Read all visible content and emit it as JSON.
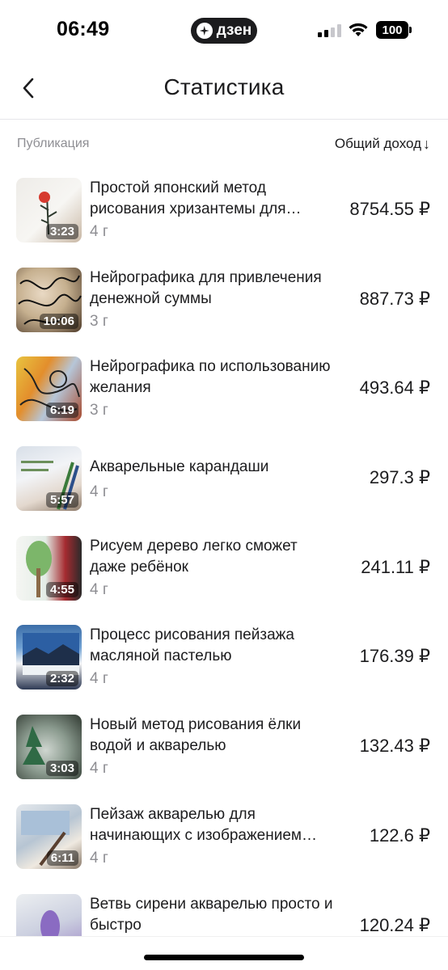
{
  "status_bar": {
    "time": "06:49",
    "app_badge": "дзен",
    "battery": "100"
  },
  "nav": {
    "title": "Статистика"
  },
  "list_header": {
    "publication_label": "Публикация",
    "income_label": "Общий доход",
    "sort_icon": "↓"
  },
  "currency": "₽",
  "items": [
    {
      "title": "Простой японский метод рисования хризантемы для начинающих",
      "age": "4 г",
      "income": "8754.55 ₽",
      "duration": "3:23"
    },
    {
      "title": "Нейрографика для привлечения денежной суммы",
      "age": "3 г",
      "income": "887.73 ₽",
      "duration": "10:06"
    },
    {
      "title": "Нейрографика по использованию желания",
      "age": "3 г",
      "income": "493.64 ₽",
      "duration": "6:19"
    },
    {
      "title": "Акварельные карандаши",
      "age": "4 г",
      "income": "297.3 ₽",
      "duration": "5:57"
    },
    {
      "title": "Рисуем дерево легко сможет даже ребёнок",
      "age": "4 г",
      "income": "241.11 ₽",
      "duration": "4:55"
    },
    {
      "title": "Процесс рисования пейзажа масляной пастелью",
      "age": "4 г",
      "income": "176.39 ₽",
      "duration": "2:32"
    },
    {
      "title": "Новый метод рисования ёлки водой и акварелью",
      "age": "4 г",
      "income": "132.43 ₽",
      "duration": "3:03"
    },
    {
      "title": "Пейзаж акварелью для начинающих с изображением птиц",
      "age": "4 г",
      "income": "122.6 ₽",
      "duration": "6:11"
    },
    {
      "title": "Ветвь сирени акварелью просто и быстро",
      "age": "",
      "income": "120.24 ₽",
      "duration": ""
    }
  ]
}
